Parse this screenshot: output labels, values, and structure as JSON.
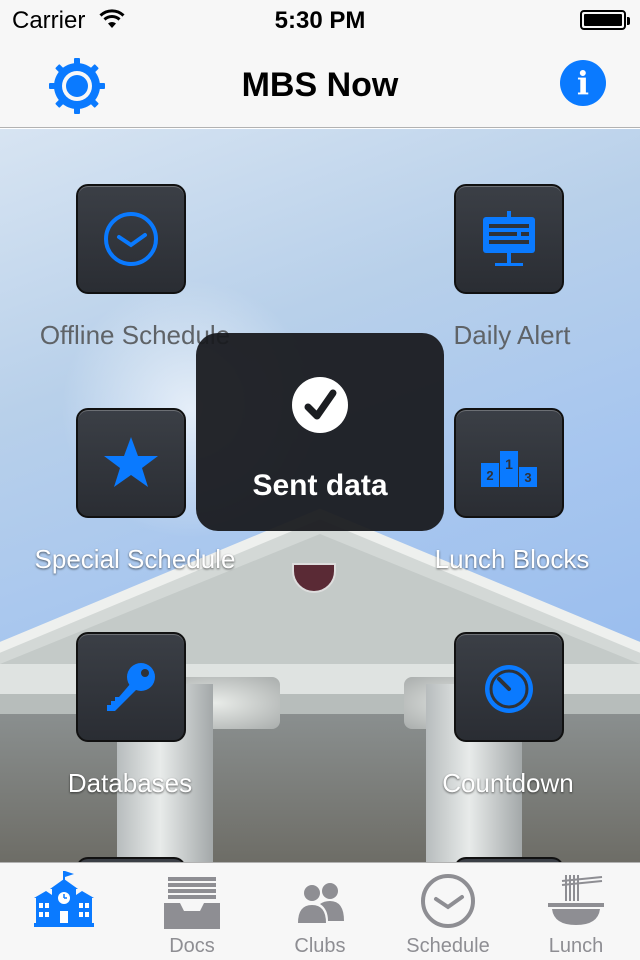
{
  "status_bar": {
    "carrier": "Carrier",
    "time": "5:30 PM"
  },
  "nav": {
    "title": "MBS Now",
    "settings_icon": "gear-icon",
    "info_icon": "info-icon",
    "info_glyph": "i"
  },
  "tiles": [
    {
      "label": "Offline Schedule",
      "icon": "clock-icon"
    },
    {
      "label": "Daily Alert",
      "icon": "billboard-icon"
    },
    {
      "label": "Special Schedule",
      "icon": "star-icon"
    },
    {
      "label": "Lunch Blocks",
      "icon": "podium-icon"
    },
    {
      "label": "Databases",
      "icon": "key-icon"
    },
    {
      "label": "Countdown",
      "icon": "timer-icon"
    }
  ],
  "hud": {
    "message": "Sent data",
    "icon": "checkmark-icon"
  },
  "tab_bar": {
    "items": [
      {
        "label": "",
        "icon": "school-building-icon",
        "selected": true
      },
      {
        "label": "Docs",
        "icon": "inbox-tray-icon",
        "selected": false
      },
      {
        "label": "Clubs",
        "icon": "people-icon",
        "selected": false
      },
      {
        "label": "Schedule",
        "icon": "clock-icon",
        "selected": false
      },
      {
        "label": "Lunch",
        "icon": "noodle-bowl-icon",
        "selected": false
      }
    ]
  },
  "colors": {
    "accent": "#0a7aff",
    "tab_inactive": "#8e8e93",
    "tile_bg": "#34373d"
  }
}
